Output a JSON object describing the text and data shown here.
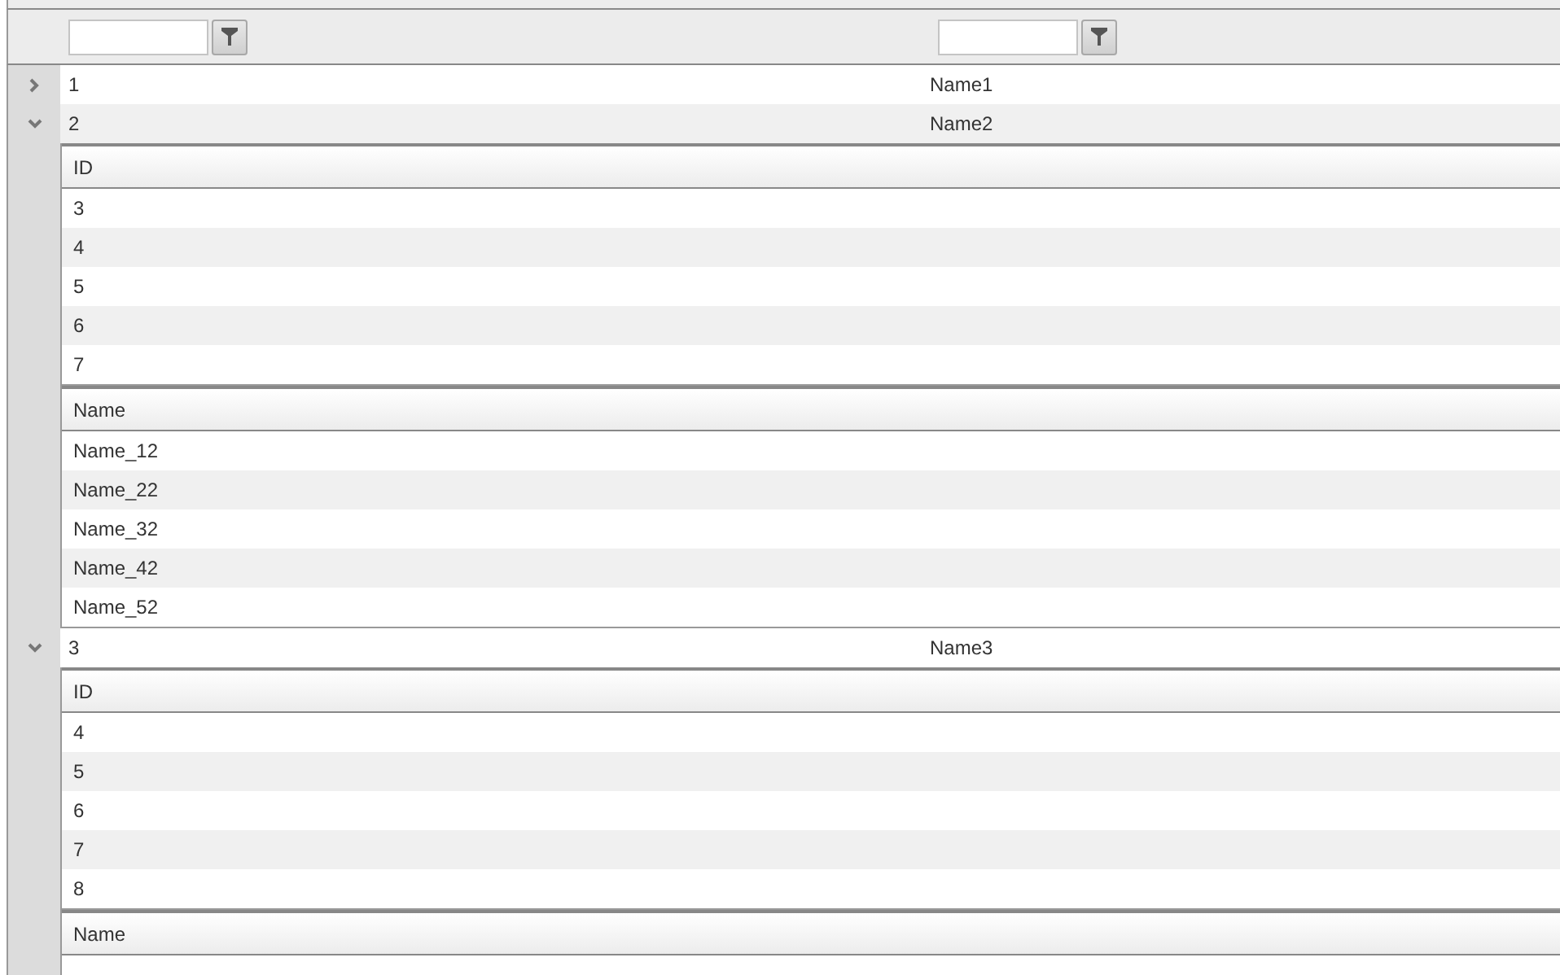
{
  "filters": [
    {
      "kind": "text"
    },
    {
      "kind": "text"
    }
  ],
  "rows": [
    {
      "id": "1",
      "name": "Name1",
      "expanded": false
    },
    {
      "id": "2",
      "name": "Name2",
      "expanded": true,
      "details": [
        {
          "header": "ID",
          "cells": [
            "3",
            "4",
            "5",
            "6",
            "7"
          ]
        },
        {
          "header": "Name",
          "cells": [
            "Name_12",
            "Name_22",
            "Name_32",
            "Name_42",
            "Name_52"
          ]
        }
      ]
    },
    {
      "id": "3",
      "name": "Name3",
      "expanded": true,
      "details": [
        {
          "header": "ID",
          "cells": [
            "4",
            "5",
            "6",
            "7",
            "8"
          ]
        },
        {
          "header": "Name"
        }
      ]
    }
  ]
}
